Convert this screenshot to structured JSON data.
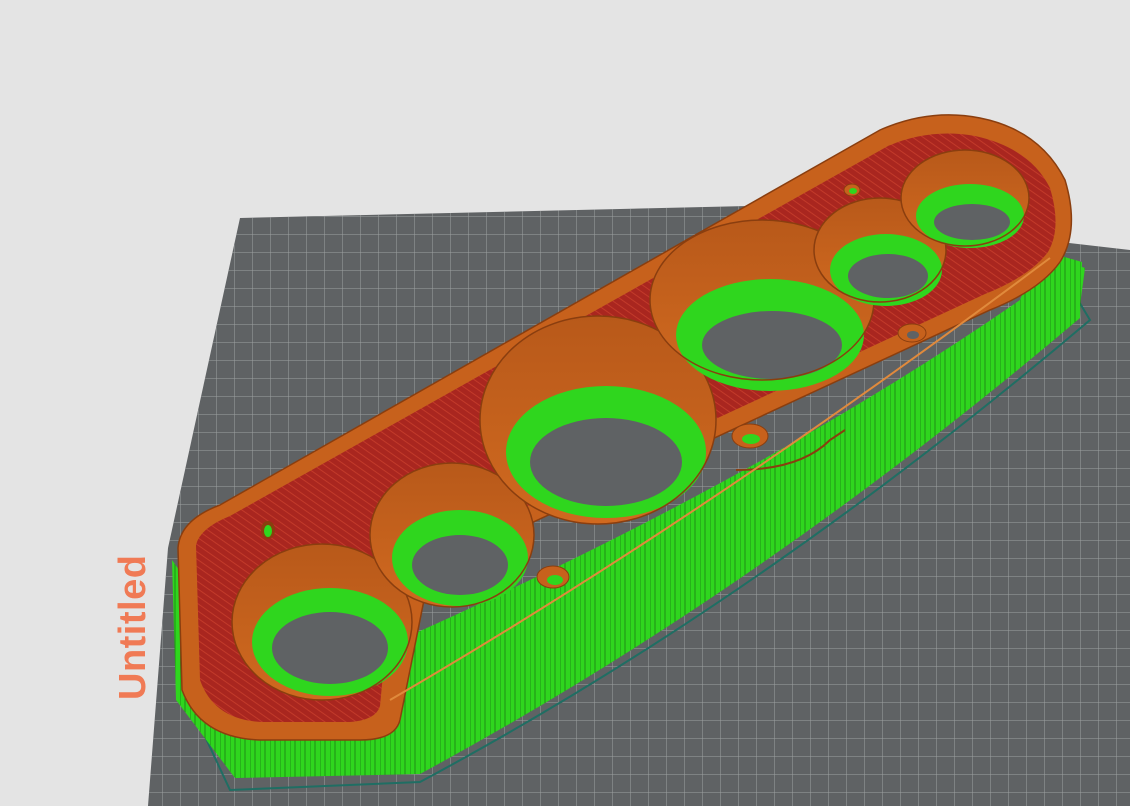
{
  "bed": {
    "name_label": "Untitled",
    "surface_color": "#5f6264",
    "grid_color": "#9ea1a2",
    "label_color": "#f07a55"
  },
  "model": {
    "perimeter_color": "#c7611c",
    "infill_color": "#a9261f",
    "support_color": "#2fd61e",
    "skirt_color": "#1f6e63",
    "gauge_cutouts": 6,
    "screw_holes": 4
  },
  "viewport": {
    "background": "#e4e4e4"
  }
}
